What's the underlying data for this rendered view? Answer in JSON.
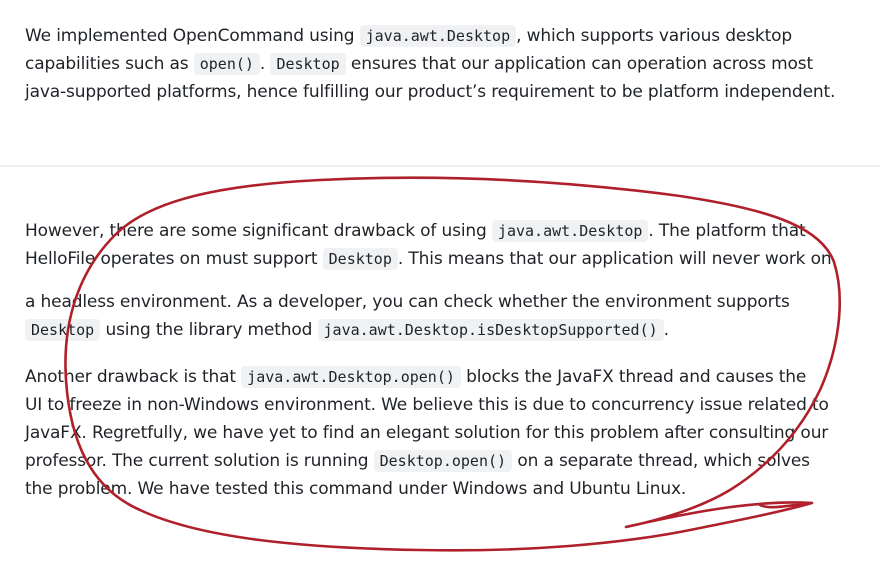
{
  "p1": {
    "l1": {
      "t1": "We implemented OpenCommand using ",
      "c1": "java.awt.Desktop",
      "t2": ", which supports various desktop"
    },
    "l2": {
      "t1": "capabilities such as ",
      "c1": "open()",
      "t2": ". ",
      "c2": "Desktop",
      "t3": " ensures that our application can operation across most"
    },
    "l3": {
      "t1": "java-supported platforms, hence fulfilling our product’s requirement to be platform independent."
    }
  },
  "p2": {
    "l1": {
      "t1": "However, there are some significant drawback of using ",
      "c1": "java.awt.Desktop",
      "t2": ". The platform that"
    },
    "l2": {
      "t1": "HelloFile operates on must support ",
      "c1": "Desktop",
      "t2": ". This means that our application will never work on"
    }
  },
  "p3": {
    "l1": {
      "t1": "a headless environment. As a developer, you can check whether the environment supports"
    },
    "l2": {
      "c1": "Desktop",
      "t1": " using the library method ",
      "c2": "java.awt.Desktop.isDesktopSupported()",
      "t2": "."
    }
  },
  "p4": {
    "l1": {
      "t1": "Another drawback is that ",
      "c1": "java.awt.Desktop.open()",
      "t2": " blocks the JavaFX thread and causes the"
    },
    "l2": {
      "t1": "UI to freeze in non-Windows environment. We believe this is due to concurrency issue related to"
    },
    "l3": {
      "t1": "JavaFX. Regretfully, we have yet to find an elegant solution for this problem after consulting our"
    },
    "l4": {
      "t1": "professor. The current solution is running ",
      "c1": "Desktop.open()",
      "t2": " on a separate thread, which solves"
    },
    "l5": {
      "t1": "the problem. We have tested this command under Windows and Ubuntu Linux."
    }
  },
  "colors": {
    "text": "#1f2328",
    "code_bg": "#eff1f3",
    "divider": "#eceef0",
    "annotation_stroke": "#b0202a"
  }
}
